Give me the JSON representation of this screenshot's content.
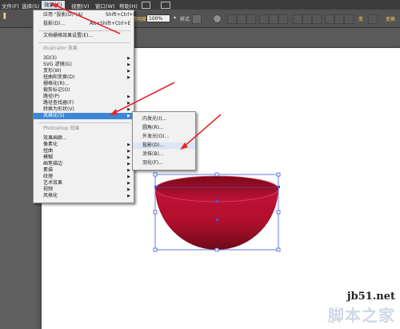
{
  "menubar": {
    "items": [
      {
        "label": "文件(F)"
      },
      {
        "label": "选择(S)"
      },
      {
        "label": "效果(C)"
      },
      {
        "label": "视图(V)"
      },
      {
        "label": "窗口(W)"
      },
      {
        "label": "帮助(H)"
      }
    ]
  },
  "toolbar": {
    "opacity_label": "透明度",
    "zoom_value": "100%",
    "style_label": "样式",
    "right_label_1": "变",
    "right_label_2": "变换"
  },
  "effect_menu": {
    "apply_last": {
      "label": "应用 \"投影(D)\"(A)",
      "shortcut": "Shift+Ctrl+E"
    },
    "last_effect": {
      "label": "投影(D)...",
      "shortcut": "Alt+Shift+Ctrl+E"
    },
    "doc_raster": "文档栅格效果设置(E)...",
    "illustrator_header": "Illustrator 效果",
    "illustrator_items": [
      "3D(3)",
      "SVG 滤镜(G)",
      "变形(W)",
      "扭曲和变换(D)",
      "栅格化(R)...",
      "裁剪标记(O)",
      "路径(P)",
      "路径查找器(F)",
      "转换为形状(V)",
      "风格化(S)"
    ],
    "photoshop_header": "Photoshop 效果",
    "photoshop_items": [
      "效果画廊...",
      "像素化",
      "扭曲",
      "模糊",
      "画笔描边",
      "素描",
      "纹理",
      "艺术效果",
      "视频",
      "风格化"
    ]
  },
  "stylize_submenu": {
    "items": [
      "内发光(I)...",
      "圆角(R)...",
      "外发光(O)...",
      "投影(D)...",
      "涂抹(B)...",
      "羽化(F)..."
    ]
  },
  "watermark": {
    "site": "jb51.net",
    "name": "脚本之家"
  },
  "colors": {
    "highlight": "#3e86d6",
    "bowl": "#b8102e",
    "arrow": "#e8262a",
    "selection": "#3b5bdb"
  }
}
